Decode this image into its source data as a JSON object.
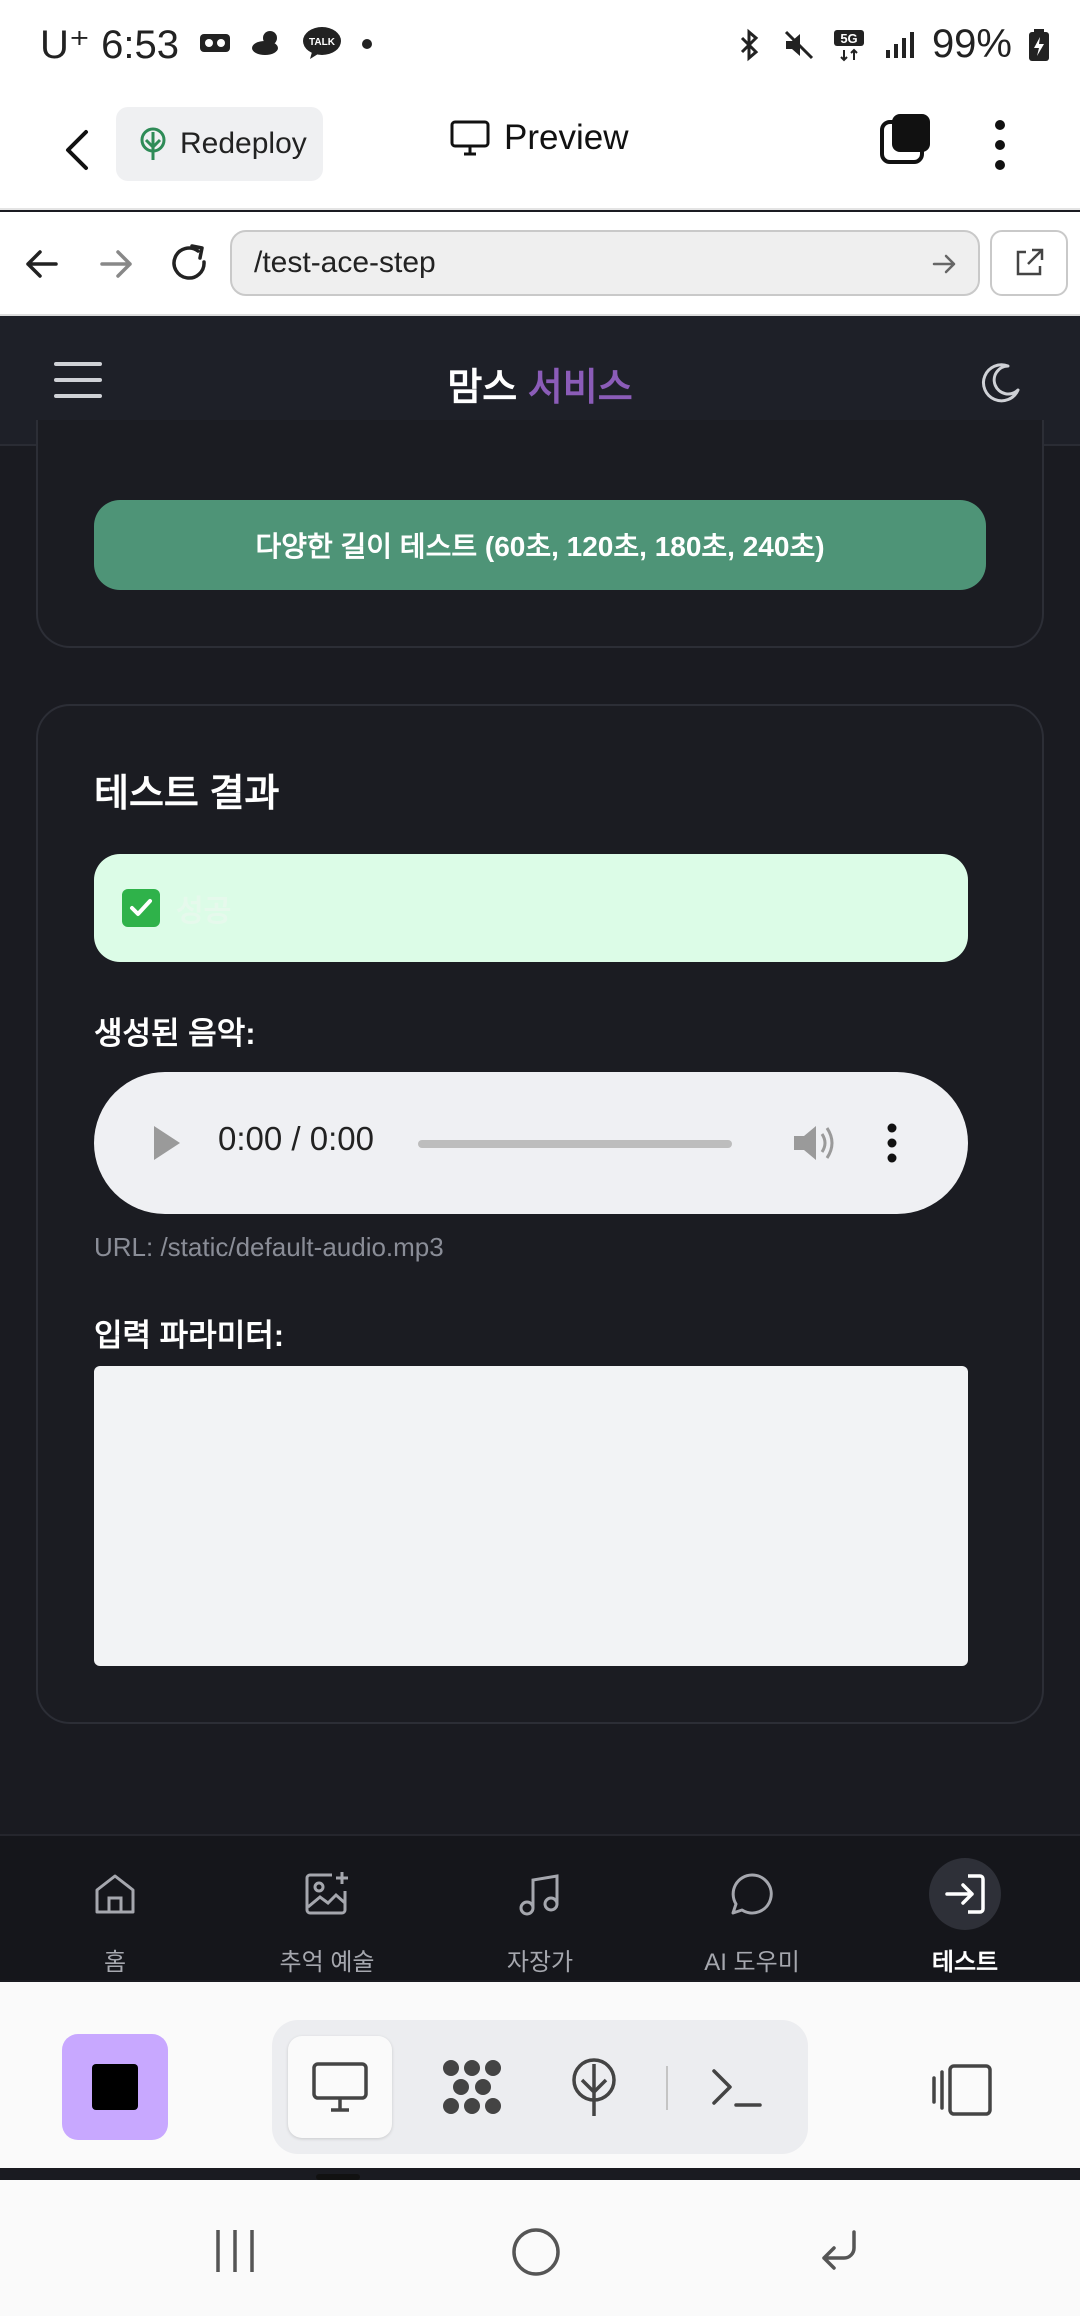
{
  "status_bar": {
    "carrier": "U⁺",
    "time": "6:53",
    "battery": "99%",
    "icons": [
      "voicemail-icon",
      "weather-icon",
      "kakaotalk-icon",
      "dot-icon",
      "bluetooth-icon",
      "mute-icon",
      "5g-icon",
      "signal-icon",
      "battery-icon"
    ]
  },
  "toolbar": {
    "redeploy_label": "Redeploy",
    "preview_label": "Preview"
  },
  "urlbar": {
    "url": "/test-ace-step"
  },
  "app": {
    "brand_main": "맘스",
    "brand_accent": "서비스",
    "accent_color": "#8b5cb8"
  },
  "content": {
    "length_test_button": "다양한 길이 테스트 (60초, 120초, 180초, 240초)",
    "results_title": "테스트 결과",
    "success_text": "성공",
    "generated_music_label": "생성된 음악:",
    "audio_time": "0:00 / 0:00",
    "audio_url": "URL: /static/default-audio.mp3",
    "params_label": "입력 파라미터:"
  },
  "bottom_nav": {
    "items": [
      {
        "label": "홈",
        "icon": "home-icon"
      },
      {
        "label": "추억 예술",
        "icon": "image-add-icon"
      },
      {
        "label": "자장가",
        "icon": "music-note-icon"
      },
      {
        "label": "AI 도우미",
        "icon": "chat-bubble-icon"
      },
      {
        "label": "테스트",
        "icon": "login-icon"
      }
    ],
    "active_index": 4
  }
}
